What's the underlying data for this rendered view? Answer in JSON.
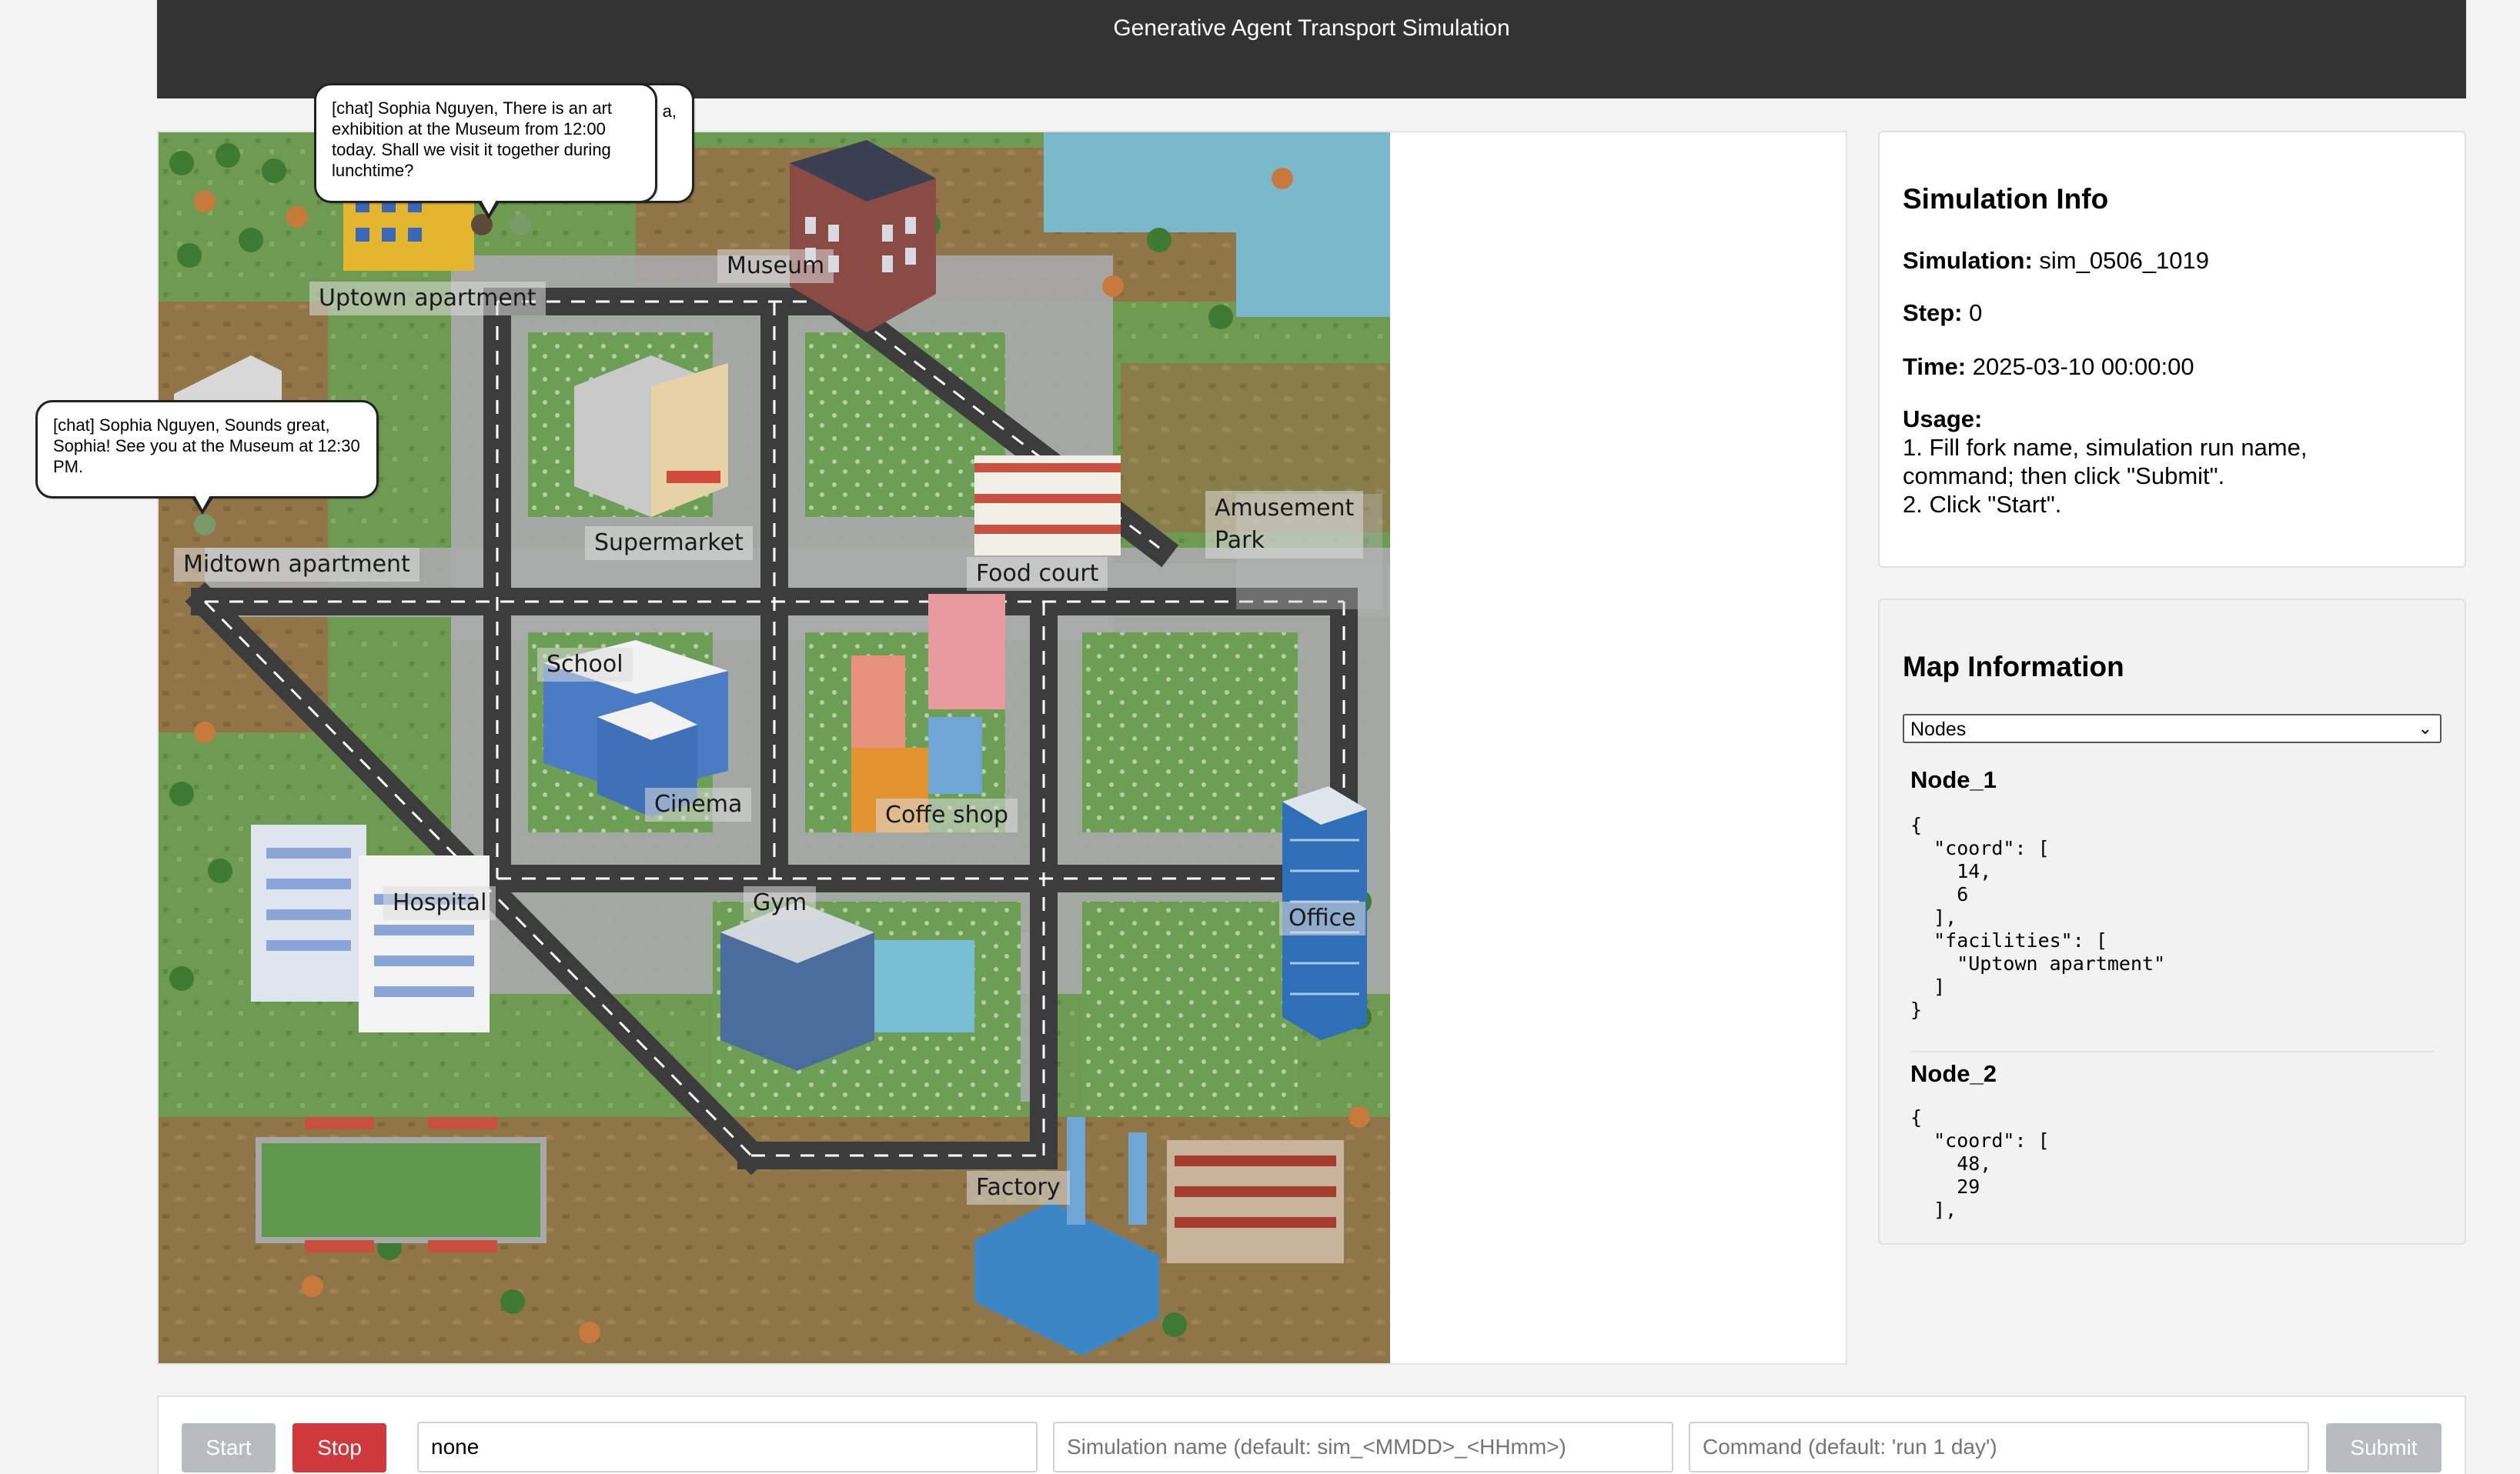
{
  "header": {
    "title": "Generative Agent Transport Simulation"
  },
  "map": {
    "places": {
      "uptown_apartment": "Uptown apartment",
      "museum": "Museum",
      "midtown_apartment": "Midtown apartment",
      "supermarket": "Supermarket",
      "amusement_park_line1": "Amusement",
      "amusement_park_line2": "Park",
      "food_court": "Food court",
      "school": "School",
      "cinema": "Cinema",
      "coffee_shop": "Coffe shop",
      "hospital": "Hospital",
      "gym": "Gym",
      "office": "Office",
      "factory": "Factory"
    },
    "chat_bubbles": [
      {
        "text": "[chat] Sophia Nguyen, There is an art exhibition at the Museum from 12:00 today. Shall we visit it together during lunchtime?"
      },
      {
        "text": "[chat] Sophia Nguyen, Sounds great, Sophia! See you at the Museum at 12:30 PM."
      }
    ],
    "back_bubble_fragment": "a,"
  },
  "simulation_info": {
    "title": "Simulation Info",
    "simulation_label": "Simulation:",
    "simulation_value": "sim_0506_1019",
    "step_label": "Step:",
    "step_value": "0",
    "time_label": "Time:",
    "time_value": "2025-03-10 00:00:00",
    "usage_label": "Usage:",
    "usage_line1": "1. Fill fork name, simulation run name,",
    "usage_line2": "command; then click \"Submit\".",
    "usage_line3": "2. Click \"Start\"."
  },
  "map_information": {
    "title": "Map Information",
    "select_value": "Nodes",
    "nodes": [
      {
        "name": "Node_1",
        "json": "{\n  \"coord\": [\n    14,\n    6\n  ],\n  \"facilities\": [\n    \"Uptown apartment\"\n  ]\n}"
      },
      {
        "name": "Node_2",
        "json": "{\n  \"coord\": [\n    48,\n    29\n  ],"
      }
    ]
  },
  "controls": {
    "start_label": "Start",
    "stop_label": "Stop",
    "fork_value": "none",
    "simulation_name_placeholder": "Simulation name (default: sim_<MMDD>_<HHmm>)",
    "command_placeholder": "Command (default: 'run 1 day')",
    "submit_label": "Submit"
  },
  "colors": {
    "header_bg": "#333333",
    "start_button": "#b8bcc0",
    "stop_button": "#d0393c",
    "submit_button": "#b8bcc0",
    "road": "#3c3c3c",
    "grass": "#6f9a52"
  }
}
